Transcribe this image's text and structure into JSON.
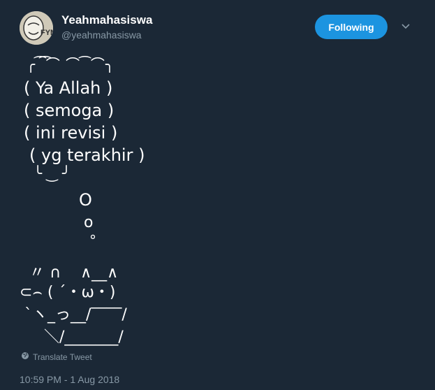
{
  "user": {
    "name": "Yeahmahasiswa",
    "handle": "@yeahmahasiswa",
    "avatar_text": "FYM"
  },
  "follow_button": {
    "label": "Following",
    "color": "#1c94e0"
  },
  "tweet": {
    "bubble_lines": [
      "( Ya Allah )",
      "( semoga )",
      "( ini revisi )",
      "( yg terakhir )"
    ],
    "bubble_top": "╭ ͡ ͡⌒ ⌒ ͡ ⌒╮",
    "bubble_bottom": "╰ ‿ ╯",
    "dots": [
      "O",
      "o",
      "°"
    ],
    "cat_lines": [
      "〃 ∩    ∧__∧",
      "⊂⌢ ( ´・ω・)",
      " `ヽ_っ__/‾‾‾‾/",
      "     ＼/_______/"
    ]
  },
  "translate_label": "Translate Tweet",
  "timestamp": "10:59 PM - 1 Aug 2018",
  "icons": {
    "caret": "chevron-down-icon",
    "globe": "globe-icon"
  }
}
